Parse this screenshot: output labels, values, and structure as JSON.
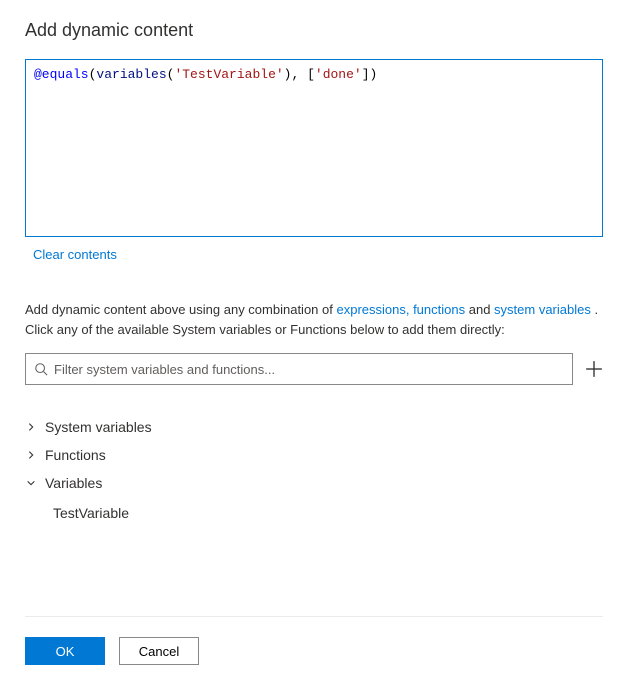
{
  "title": "Add dynamic content",
  "expression": {
    "raw": "@equals(variables('TestVariable'), ['done'])",
    "tokens": [
      {
        "t": "@equals",
        "c": "func"
      },
      {
        "t": "(",
        "c": "plain"
      },
      {
        "t": "variables",
        "c": "name"
      },
      {
        "t": "(",
        "c": "plain"
      },
      {
        "t": "'TestVariable'",
        "c": "str"
      },
      {
        "t": "), [",
        "c": "plain"
      },
      {
        "t": "'done'",
        "c": "str"
      },
      {
        "t": "])",
        "c": "plain"
      }
    ]
  },
  "clear_label": "Clear contents",
  "help": {
    "before": "Add dynamic content above using any combination of ",
    "link1": "expressions, functions",
    "mid": " and ",
    "link2": "system variables",
    "after": " . Click any of the available System variables or Functions below to add them directly:"
  },
  "filter": {
    "placeholder": "Filter system variables and functions..."
  },
  "tree": {
    "system_variables": {
      "label": "System variables",
      "expanded": false
    },
    "functions": {
      "label": "Functions",
      "expanded": false
    },
    "variables": {
      "label": "Variables",
      "expanded": true,
      "items": [
        "TestVariable"
      ]
    }
  },
  "buttons": {
    "ok": "OK",
    "cancel": "Cancel"
  }
}
